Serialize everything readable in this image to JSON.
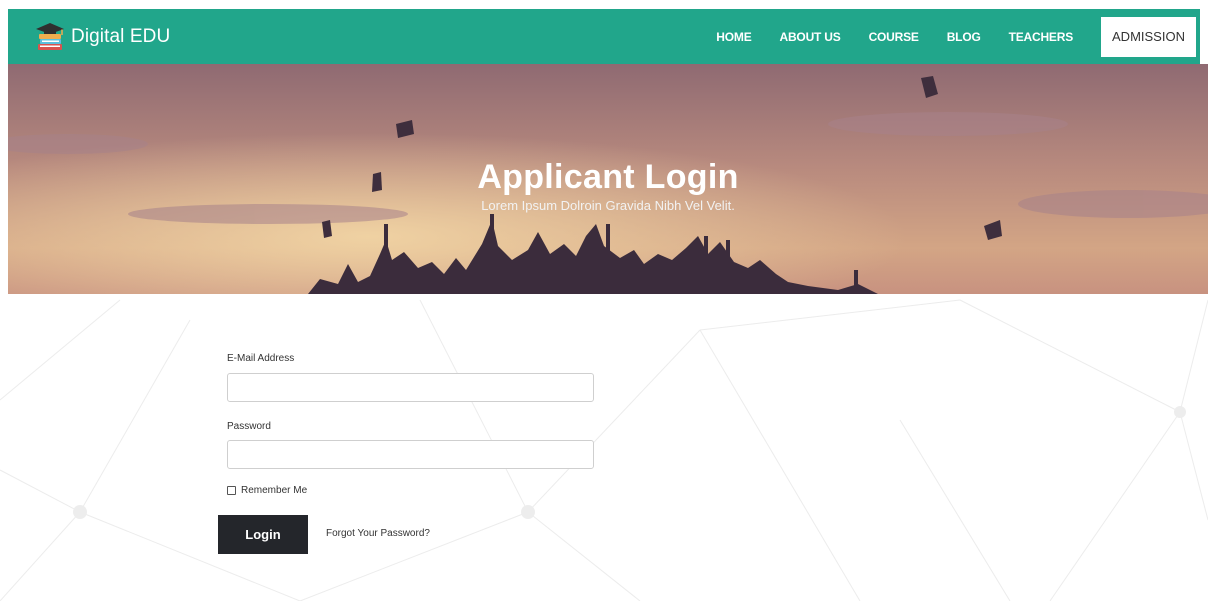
{
  "brand": {
    "name": "Digital EDU",
    "logo_icon": "books-graduation-cap-icon"
  },
  "nav": {
    "items": [
      {
        "label": "HOME"
      },
      {
        "label": "ABOUT US"
      },
      {
        "label": "COURSE"
      },
      {
        "label": "BLOG"
      },
      {
        "label": "TEACHERS"
      }
    ],
    "admission_label": "ADMISSION"
  },
  "hero": {
    "title": "Applicant Login",
    "subtitle": "Lorem Ipsum Dolroin Gravida Nibh Vel Velit."
  },
  "form": {
    "email_label": "E-Mail Address",
    "email_value": "",
    "password_label": "Password",
    "password_value": "",
    "remember_label": "Remember Me",
    "remember_checked": false,
    "login_label": "Login",
    "forgot_label": "Forgot Your Password?"
  },
  "colors": {
    "navbar": "#21a68b",
    "login_button": "#24262b",
    "admission_button": "#ffffff"
  }
}
